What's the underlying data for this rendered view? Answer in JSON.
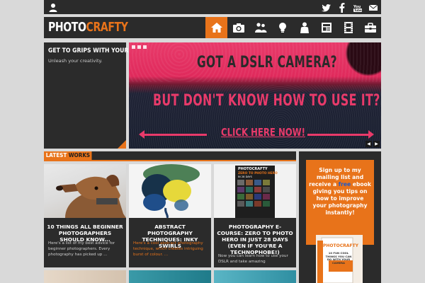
{
  "site": {
    "logo_part1": "PHOTO",
    "logo_part2": "CRAFTY",
    "accent": "#e8731a",
    "dark": "#2b2b2b"
  },
  "topbar": {
    "user_icon": "user-icon",
    "social_icons": [
      "twitter-icon",
      "facebook-icon",
      "youtube-icon",
      "email-icon"
    ]
  },
  "nav": {
    "items": [
      {
        "icon": "home-icon",
        "active": true
      },
      {
        "icon": "camera-icon",
        "active": false
      },
      {
        "icon": "people-icon",
        "active": false
      },
      {
        "icon": "lightbulb-icon",
        "active": false
      },
      {
        "icon": "person-icon",
        "active": false
      },
      {
        "icon": "newspaper-icon",
        "active": false
      },
      {
        "icon": "film-icon",
        "active": false
      },
      {
        "icon": "toolbox-icon",
        "active": false
      }
    ]
  },
  "featured": {
    "title": "GET TO GRIPS WITH YOUR DSLR",
    "subtitle": "Unleash your creativity."
  },
  "hero": {
    "line1": "GOT A DSLR CAMERA?",
    "line2": "BUT DON'T KNOW HOW TO USE IT?",
    "cta": "CLICK HERE NOW!",
    "prev": "◀",
    "next": "▶"
  },
  "latest": {
    "label_a": "LATEST",
    "label_b": " WORKS"
  },
  "cards": [
    {
      "title": "10 THINGS ALL BEGINNER PHOTOGRAPHERS SHOULD KNOW...",
      "desc": "Here's a list of my best advice for beginner photographers. Every photography has picked up ..."
    },
    {
      "title": "ABSTRACT PHOTOGRAPHY TECHNIQUES: INKY SWIRLS",
      "desc": "Here's a cool abstract photography technique, which creates intriguing burst of colour. ..."
    },
    {
      "title": "PHOTOGRAPHY E-COURSE: ZERO TO PHOTO HERO IN JUST 28 DAYS (EVEN IF YOU'RE A TECHNOPHOBE!)",
      "desc": "Now you can learn how to use your DSLR and take amazing"
    }
  ],
  "course_cover": {
    "brand": "PHOTOCRAFTY",
    "title": "ZERO TO PHOTO HERO",
    "sub": "IN 28 DAYS"
  },
  "sidebar": {
    "signup_pre": "Sign up to my mailing list and receive a ",
    "signup_free": "free",
    "signup_post": " ebook giving you tips on how to improve your photography instantly!",
    "book_brand": "PHOTOCRAFTY",
    "book_title": "10 FUN COOL THINGS YOU CAN DO WITH YOUR CAMERA"
  }
}
